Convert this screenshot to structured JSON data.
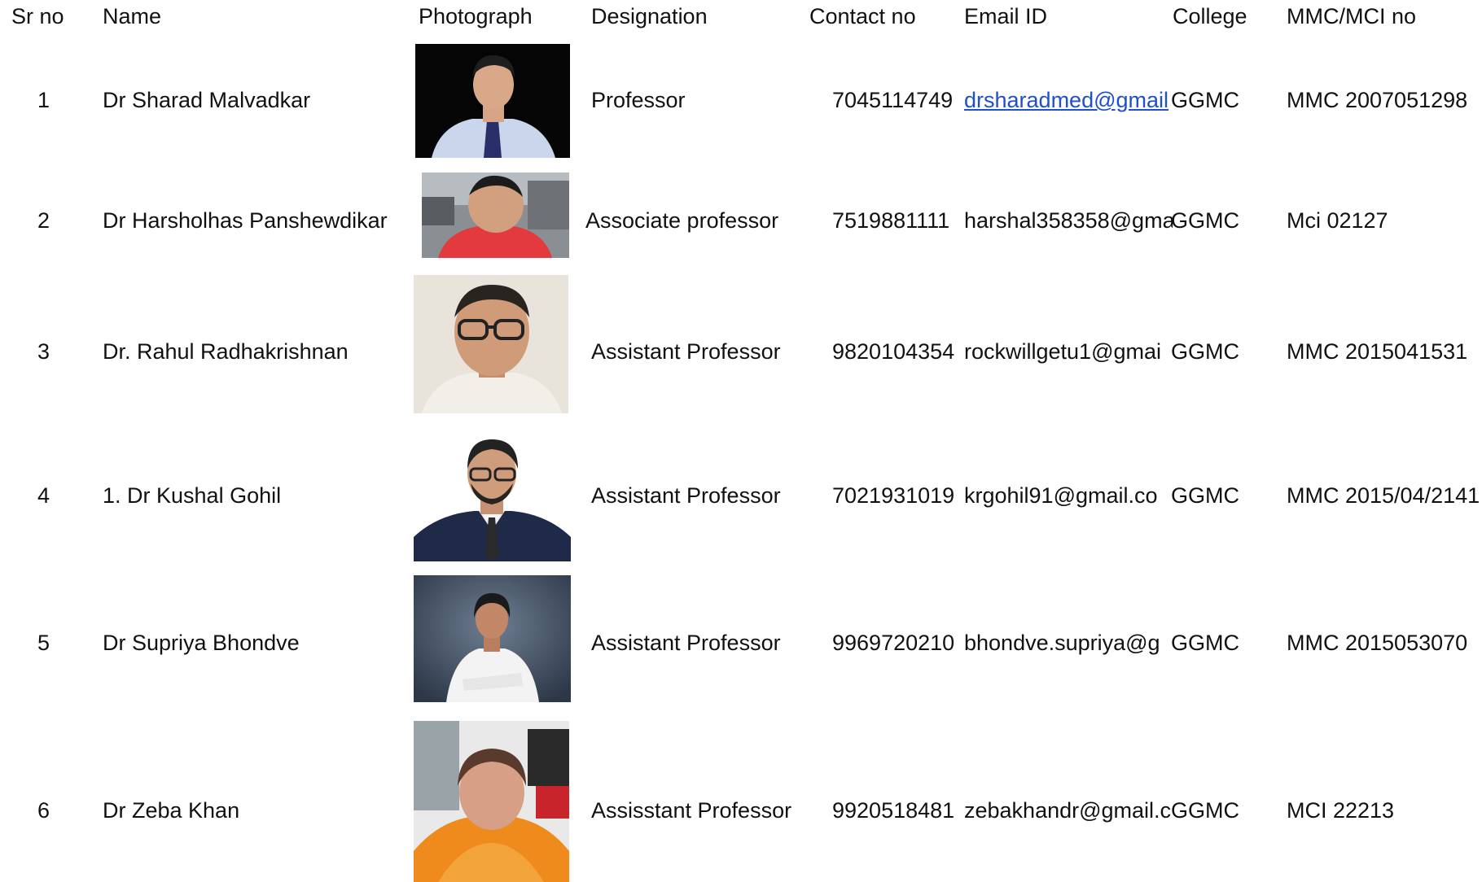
{
  "headers": {
    "sr_no": "Sr no",
    "name": "Name",
    "photograph": "Photograph",
    "designation": "Designation",
    "contact_no": "Contact no",
    "email_id": "Email ID",
    "college": "College",
    "mmc_mci_no": "MMC/MCI no"
  },
  "rows": [
    {
      "sr": "1",
      "name": "Dr Sharad Malvadkar",
      "designation": "Professor",
      "contact": "7045114749",
      "email": "drsharadmed@gmail",
      "college": "GGMC",
      "reg": "MMC 2007051298",
      "photo_icon": "portrait-photo-icon"
    },
    {
      "sr": "2",
      "name": "Dr Harsholhas Panshewdikar",
      "designation": "Associate professor",
      "contact": "7519881111",
      "email": "harshal358358@gma",
      "college": "GGMC",
      "reg": "Mci 02127",
      "photo_icon": "portrait-photo-icon"
    },
    {
      "sr": "3",
      "name": "Dr. Rahul Radhakrishnan",
      "designation": "Assistant Professor",
      "contact": "9820104354",
      "email": "rockwillgetu1@gmai",
      "college": "GGMC",
      "reg": "MMC  2015041531",
      "photo_icon": "portrait-photo-icon"
    },
    {
      "sr": "4",
      "name": "1. Dr Kushal Gohil",
      "designation": "Assistant Professor",
      "contact": "7021931019",
      "email": "krgohil91@gmail.co",
      "college": "GGMC",
      "reg": "MMC 2015/04/2141",
      "photo_icon": "portrait-photo-icon"
    },
    {
      "sr": "5",
      "name": "Dr Supriya Bhondve",
      "designation": "Assistant Professor",
      "contact": "9969720210",
      "email": "bhondve.supriya@g",
      "college": "GGMC",
      "reg": "MMC 2015053070",
      "photo_icon": "portrait-photo-icon"
    },
    {
      "sr": "6",
      "name": "Dr Zeba Khan",
      "designation": "Assisstant Professor",
      "contact": "9920518481",
      "email": "zebakhandr@gmail.c",
      "college": "GGMC",
      "reg": "MCI 22213",
      "photo_icon": "portrait-photo-icon"
    }
  ],
  "colors": {
    "link": "#1f4fd0",
    "text": "#111111",
    "background": "#ffffff"
  }
}
